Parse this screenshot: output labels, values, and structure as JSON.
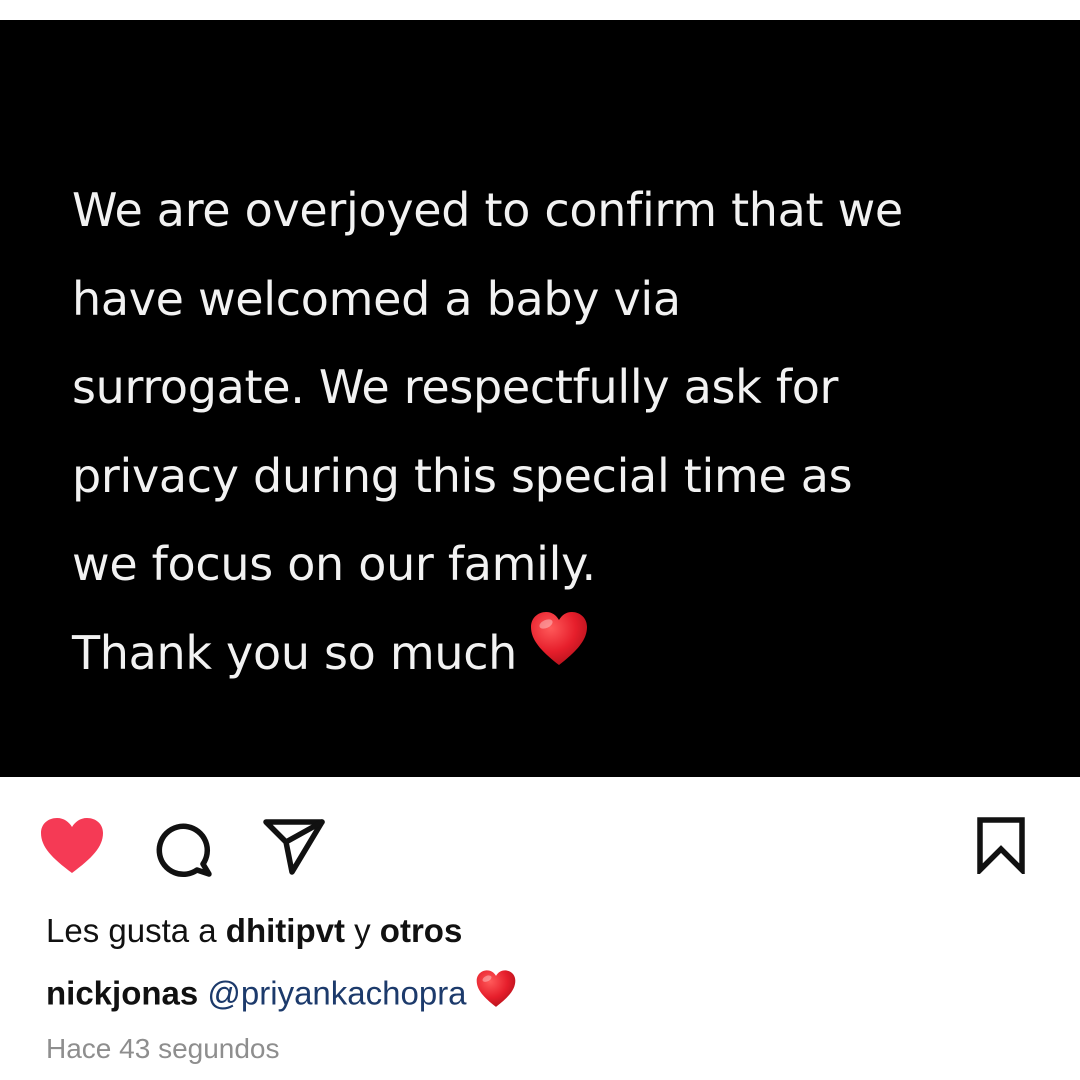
{
  "post": {
    "text_lines": [
      "We are overjoyed to confirm that we",
      "have welcomed a baby via",
      "surrogate. We respectfully ask for",
      "privacy during this special time as",
      "we focus on our family.",
      "Thank you so much"
    ],
    "heart_emoji_icon": "red-heart-icon",
    "background_color": "#000000",
    "text_color": "#f2f2f2"
  },
  "actions": {
    "like": {
      "icon": "heart-icon",
      "liked": true,
      "color": "#f53a55"
    },
    "comment": {
      "icon": "comment-icon"
    },
    "share": {
      "icon": "send-icon"
    },
    "save": {
      "icon": "bookmark-icon"
    }
  },
  "likes": {
    "prefix": "Les gusta a",
    "user": "dhitipvt",
    "connector": "y",
    "others": "otros"
  },
  "caption": {
    "username": "nickjonas",
    "mention": "@priyankachopra",
    "emoji_icon": "red-heart-icon"
  },
  "timestamp": "Hace 43 segundos",
  "colors": {
    "like_red": "#f53a55",
    "mention_blue": "#1c3a6b",
    "timestamp_gray": "#8e8e8e"
  }
}
